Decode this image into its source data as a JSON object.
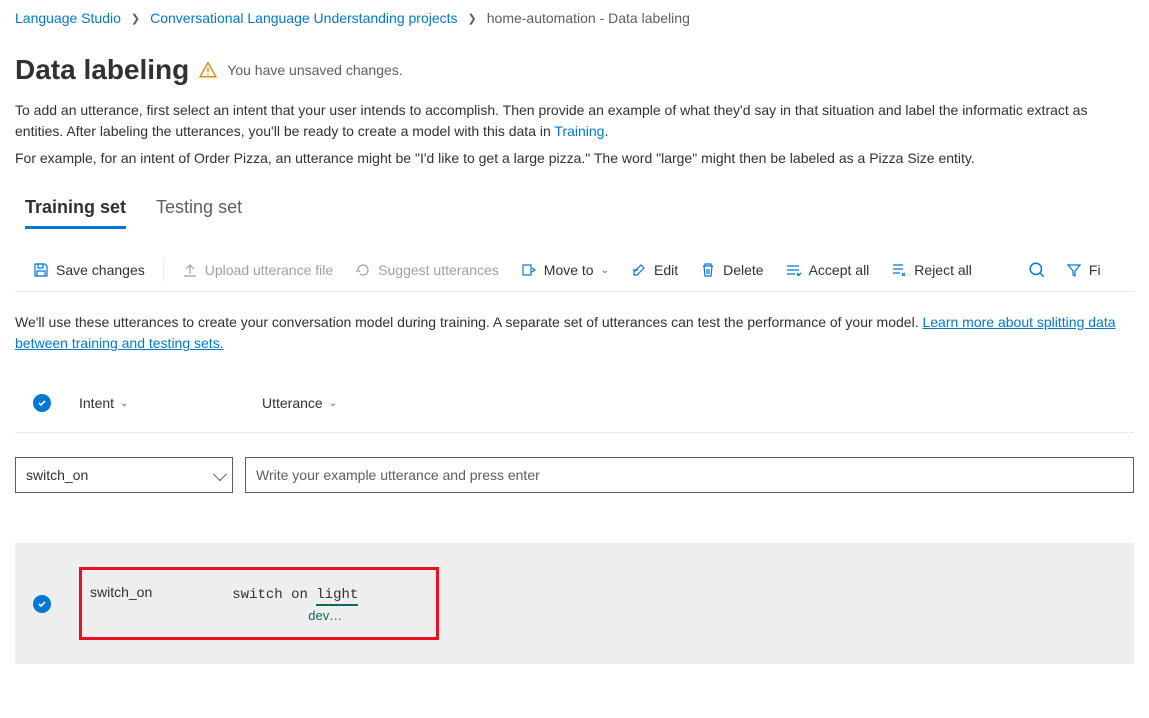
{
  "breadcrumb": {
    "items": [
      {
        "label": "Language Studio",
        "link": true
      },
      {
        "label": "Conversational Language Understanding projects",
        "link": true
      },
      {
        "label": "home-automation - Data labeling",
        "link": false
      }
    ]
  },
  "header": {
    "title": "Data labeling",
    "unsaved_message": "You have unsaved changes."
  },
  "description": {
    "line1_a": "To add an utterance, first select an intent that your user intends to accomplish. Then provide an example of what they'd say in that situation and label the informatic extract as entities. After labeling the utterances, you'll be ready to create a model with this data in ",
    "training_link": "Training",
    "line1_b": ".",
    "line2": "For example, for an intent of Order Pizza, an utterance might be \"I'd like to get a large pizza.\" The word \"large\" might then be labeled as a Pizza Size entity."
  },
  "tabs": [
    {
      "label": "Training set",
      "active": true
    },
    {
      "label": "Testing set",
      "active": false
    }
  ],
  "toolbar": {
    "save": "Save changes",
    "upload": "Upload utterance file",
    "suggest": "Suggest utterances",
    "move_to": "Move to",
    "edit": "Edit",
    "delete": "Delete",
    "accept_all": "Accept all",
    "reject_all": "Reject all",
    "filter": "Fi"
  },
  "info": {
    "text": "We'll use these utterances to create your conversation model during training. A separate set of utterances can test the performance of your model. ",
    "link": "Learn more about splitting data between training and testing sets."
  },
  "table": {
    "columns": {
      "intent": "Intent",
      "utterance": "Utterance"
    }
  },
  "inputs": {
    "intent_selected": "switch_on",
    "utterance_placeholder": "Write your example utterance and press enter"
  },
  "rows": [
    {
      "intent": "switch_on",
      "utterance_prefix": "switch on ",
      "entity_text": "light",
      "entity_label": "dev…"
    }
  ]
}
